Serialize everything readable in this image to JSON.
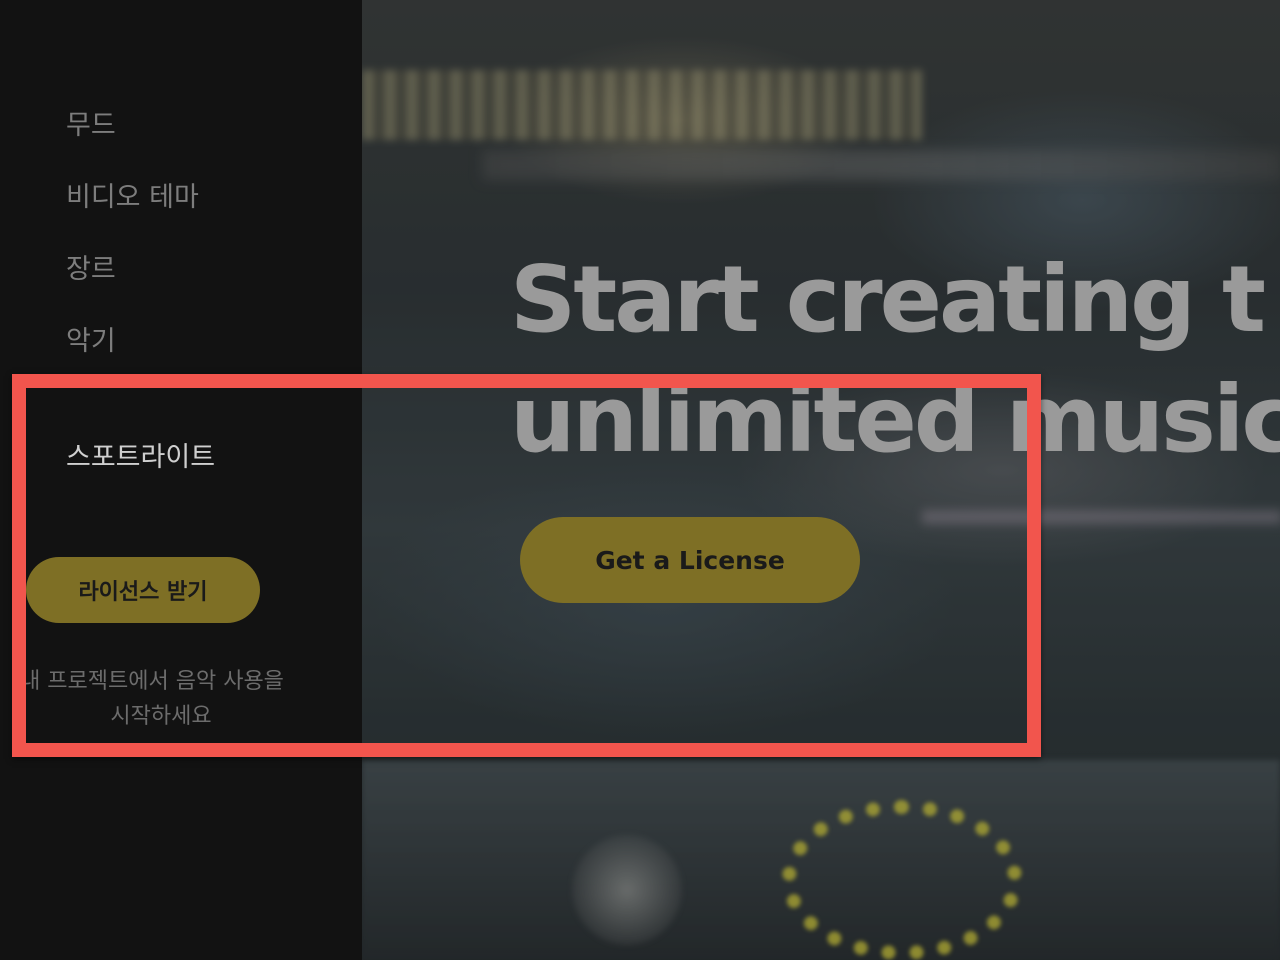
{
  "sidebar": {
    "nav_items": [
      {
        "label": "무드"
      },
      {
        "label": "비디오 테마"
      },
      {
        "label": "장르"
      },
      {
        "label": "악기"
      }
    ],
    "spotlight_label": "스포트라이트",
    "license_button_label": "라이선스 받기",
    "promo_line1": "내 프로젝트에서 음악 사용을",
    "promo_line2": "시작하세요"
  },
  "hero": {
    "title_line1": "Start creating t",
    "title_line2": "unlimited music",
    "cta_label": "Get a License"
  },
  "colors": {
    "sidebar_bg": "#121212",
    "accent": "#7e6f25",
    "highlight": "#f2554d",
    "nav_text": "#7d7d7d"
  }
}
